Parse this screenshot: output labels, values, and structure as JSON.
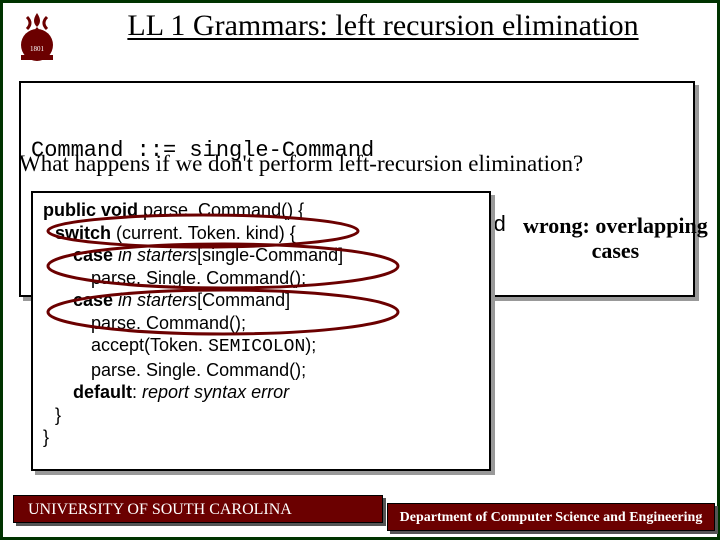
{
  "title": "LL 1 Grammars: left recursion elimination",
  "grammar": {
    "line1": "Command ::= single-Command",
    "line2": "          | Command ; single-Command"
  },
  "question": "What happens if we don't perform left-recursion elimination?",
  "code": {
    "l1a": "public void",
    "l1b": " parse. Command() {",
    "l2a": "switch",
    "l2b": " (current. Token. kind) {",
    "l3a": "case ",
    "l3b": "in starters",
    "l3c": "[single-Command]",
    "l4": "parse. Single. Command();",
    "l5a": "case ",
    "l5b": "in starters",
    "l5c": "[Command]",
    "l6": "parse. Command();",
    "l7a": "accept(Token. ",
    "l7b": "SEMICOLON",
    "l7c": ");",
    "l8": "parse. Single. Command();",
    "l9a": "default",
    "l9b": ": ",
    "l9c": "report syntax error",
    "l10": "}",
    "l11": "}"
  },
  "annotation": {
    "line1": "wrong: overlapping",
    "line2": "cases"
  },
  "footer": {
    "left": "UNIVERSITY OF SOUTH CAROLINA",
    "right": "Department of Computer Science and Engineering"
  }
}
